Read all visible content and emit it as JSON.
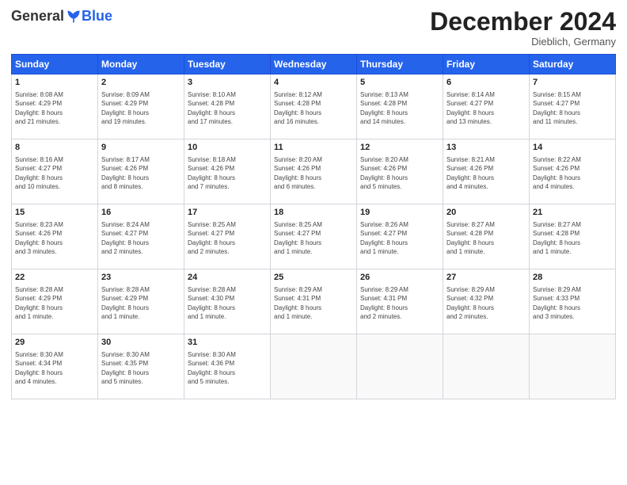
{
  "header": {
    "logo_general": "General",
    "logo_blue": "Blue",
    "month_title": "December 2024",
    "location": "Dieblich, Germany"
  },
  "weekdays": [
    "Sunday",
    "Monday",
    "Tuesday",
    "Wednesday",
    "Thursday",
    "Friday",
    "Saturday"
  ],
  "weeks": [
    [
      {
        "day": "1",
        "info": "Sunrise: 8:08 AM\nSunset: 4:29 PM\nDaylight: 8 hours\nand 21 minutes."
      },
      {
        "day": "2",
        "info": "Sunrise: 8:09 AM\nSunset: 4:29 PM\nDaylight: 8 hours\nand 19 minutes."
      },
      {
        "day": "3",
        "info": "Sunrise: 8:10 AM\nSunset: 4:28 PM\nDaylight: 8 hours\nand 17 minutes."
      },
      {
        "day": "4",
        "info": "Sunrise: 8:12 AM\nSunset: 4:28 PM\nDaylight: 8 hours\nand 16 minutes."
      },
      {
        "day": "5",
        "info": "Sunrise: 8:13 AM\nSunset: 4:28 PM\nDaylight: 8 hours\nand 14 minutes."
      },
      {
        "day": "6",
        "info": "Sunrise: 8:14 AM\nSunset: 4:27 PM\nDaylight: 8 hours\nand 13 minutes."
      },
      {
        "day": "7",
        "info": "Sunrise: 8:15 AM\nSunset: 4:27 PM\nDaylight: 8 hours\nand 11 minutes."
      }
    ],
    [
      {
        "day": "8",
        "info": "Sunrise: 8:16 AM\nSunset: 4:27 PM\nDaylight: 8 hours\nand 10 minutes."
      },
      {
        "day": "9",
        "info": "Sunrise: 8:17 AM\nSunset: 4:26 PM\nDaylight: 8 hours\nand 8 minutes."
      },
      {
        "day": "10",
        "info": "Sunrise: 8:18 AM\nSunset: 4:26 PM\nDaylight: 8 hours\nand 7 minutes."
      },
      {
        "day": "11",
        "info": "Sunrise: 8:20 AM\nSunset: 4:26 PM\nDaylight: 8 hours\nand 6 minutes."
      },
      {
        "day": "12",
        "info": "Sunrise: 8:20 AM\nSunset: 4:26 PM\nDaylight: 8 hours\nand 5 minutes."
      },
      {
        "day": "13",
        "info": "Sunrise: 8:21 AM\nSunset: 4:26 PM\nDaylight: 8 hours\nand 4 minutes."
      },
      {
        "day": "14",
        "info": "Sunrise: 8:22 AM\nSunset: 4:26 PM\nDaylight: 8 hours\nand 4 minutes."
      }
    ],
    [
      {
        "day": "15",
        "info": "Sunrise: 8:23 AM\nSunset: 4:26 PM\nDaylight: 8 hours\nand 3 minutes."
      },
      {
        "day": "16",
        "info": "Sunrise: 8:24 AM\nSunset: 4:27 PM\nDaylight: 8 hours\nand 2 minutes."
      },
      {
        "day": "17",
        "info": "Sunrise: 8:25 AM\nSunset: 4:27 PM\nDaylight: 8 hours\nand 2 minutes."
      },
      {
        "day": "18",
        "info": "Sunrise: 8:25 AM\nSunset: 4:27 PM\nDaylight: 8 hours\nand 1 minute."
      },
      {
        "day": "19",
        "info": "Sunrise: 8:26 AM\nSunset: 4:27 PM\nDaylight: 8 hours\nand 1 minute."
      },
      {
        "day": "20",
        "info": "Sunrise: 8:27 AM\nSunset: 4:28 PM\nDaylight: 8 hours\nand 1 minute."
      },
      {
        "day": "21",
        "info": "Sunrise: 8:27 AM\nSunset: 4:28 PM\nDaylight: 8 hours\nand 1 minute."
      }
    ],
    [
      {
        "day": "22",
        "info": "Sunrise: 8:28 AM\nSunset: 4:29 PM\nDaylight: 8 hours\nand 1 minute."
      },
      {
        "day": "23",
        "info": "Sunrise: 8:28 AM\nSunset: 4:29 PM\nDaylight: 8 hours\nand 1 minute."
      },
      {
        "day": "24",
        "info": "Sunrise: 8:28 AM\nSunset: 4:30 PM\nDaylight: 8 hours\nand 1 minute."
      },
      {
        "day": "25",
        "info": "Sunrise: 8:29 AM\nSunset: 4:31 PM\nDaylight: 8 hours\nand 1 minute."
      },
      {
        "day": "26",
        "info": "Sunrise: 8:29 AM\nSunset: 4:31 PM\nDaylight: 8 hours\nand 2 minutes."
      },
      {
        "day": "27",
        "info": "Sunrise: 8:29 AM\nSunset: 4:32 PM\nDaylight: 8 hours\nand 2 minutes."
      },
      {
        "day": "28",
        "info": "Sunrise: 8:29 AM\nSunset: 4:33 PM\nDaylight: 8 hours\nand 3 minutes."
      }
    ],
    [
      {
        "day": "29",
        "info": "Sunrise: 8:30 AM\nSunset: 4:34 PM\nDaylight: 8 hours\nand 4 minutes."
      },
      {
        "day": "30",
        "info": "Sunrise: 8:30 AM\nSunset: 4:35 PM\nDaylight: 8 hours\nand 5 minutes."
      },
      {
        "day": "31",
        "info": "Sunrise: 8:30 AM\nSunset: 4:36 PM\nDaylight: 8 hours\nand 5 minutes."
      },
      null,
      null,
      null,
      null
    ]
  ]
}
